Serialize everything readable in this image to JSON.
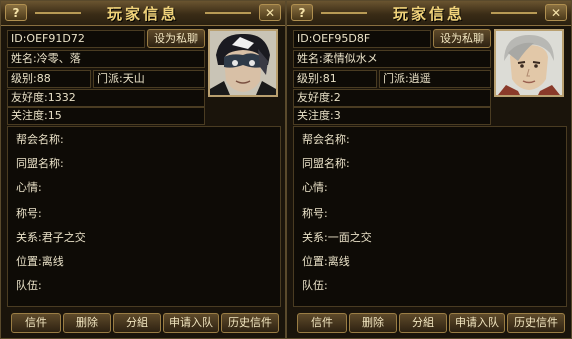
{
  "title": "玩家信息",
  "help_glyph": "?",
  "close_glyph": "✕",
  "private_chat_label": "设为私聊",
  "labels": {
    "id": "ID:",
    "name": "姓名:",
    "level": "级别:",
    "sect": "门派:",
    "friendliness": "友好度:",
    "attention": "关注度:",
    "guild": "帮会名称:",
    "alliance": "同盟名称:",
    "mood": "心情:",
    "nickname": "称号:",
    "relation": "关系:",
    "location": "位置:",
    "team": "队伍:"
  },
  "buttons": {
    "mail": "信件",
    "delete": "删除",
    "group": "分組",
    "apply_team": "申请入队",
    "history_mail": "历史信件"
  },
  "players": [
    {
      "id": "OEF91D72",
      "name": "冷零、落",
      "level": "88",
      "sect": "天山",
      "friendliness": "1332",
      "attention": "15",
      "guild": "",
      "alliance": "",
      "mood": "",
      "nickname": "",
      "relation": "君子之交",
      "location": "离线",
      "team": ""
    },
    {
      "id": "OEF95D8F",
      "name": "柔情似水メ",
      "level": "81",
      "sect": "逍遥",
      "friendliness": "2",
      "attention": "3",
      "guild": "",
      "alliance": "",
      "mood": "",
      "nickname": "",
      "relation": "一面之交",
      "location": "离线",
      "team": ""
    }
  ]
}
